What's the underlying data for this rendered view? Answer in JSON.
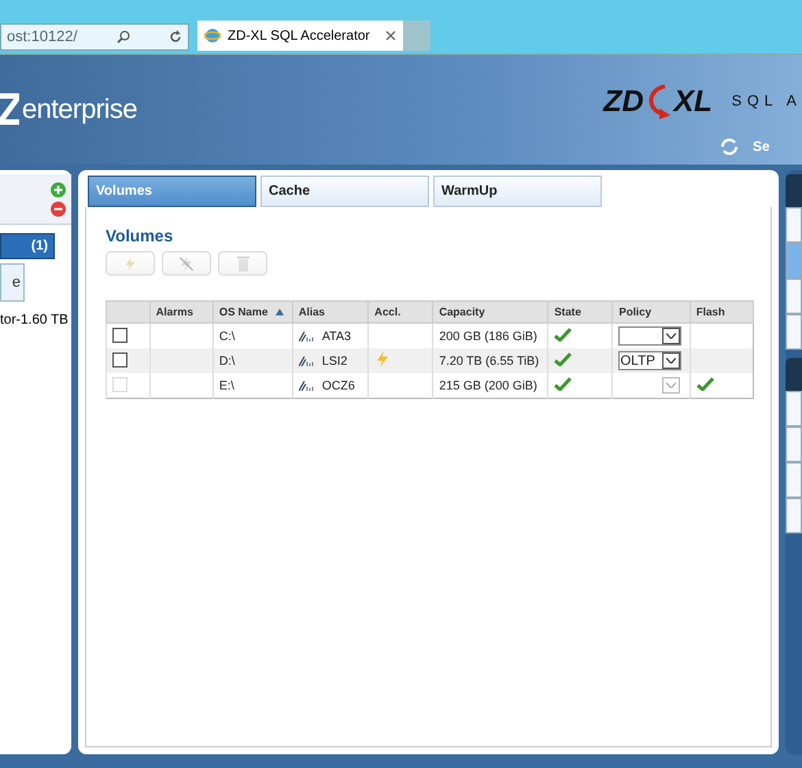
{
  "browser": {
    "address": "ost:10122/",
    "tab_title": "ZD-XL SQL Accelerator"
  },
  "header": {
    "brand": "enterprise",
    "logo_left": "ZD",
    "logo_right": "XL",
    "product": "SQL A",
    "link": "Se"
  },
  "left_panel": {
    "count": "(1)",
    "item_letter": "e",
    "item_caption": "tor-1.60 TB"
  },
  "tabs": [
    {
      "label": "Volumes",
      "selected": true
    },
    {
      "label": "Cache",
      "selected": false
    },
    {
      "label": "WarmUp",
      "selected": false
    }
  ],
  "heading": "Volumes",
  "toolbar": [
    {
      "kind": "accelerate",
      "disabled": true
    },
    {
      "kind": "decelerate",
      "disabled": true
    },
    {
      "kind": "delete",
      "disabled": true
    }
  ],
  "table": {
    "columns": [
      {
        "sorted": false
      },
      {
        "label": "Alarms",
        "sorted": false
      },
      {
        "label": "OS Name",
        "sorted": true
      },
      {
        "label": "Alias",
        "sorted": false
      },
      {
        "label": "Accl.",
        "sorted": false
      },
      {
        "label": "Capacity",
        "sorted": false
      },
      {
        "label": "State",
        "sorted": false
      },
      {
        "label": "Policy",
        "sorted": false
      },
      {
        "label": "Flash",
        "sorted": false
      }
    ],
    "rows": [
      {
        "checked": false,
        "check_disabled": false,
        "os_name": "C:\\",
        "alias": "ATA3",
        "accelerated": false,
        "capacity": "200 GB (186 GiB)",
        "state_ok": true,
        "policy": "",
        "policy_disabled": false,
        "flash": false
      },
      {
        "checked": false,
        "check_disabled": false,
        "os_name": "D:\\",
        "alias": "LSI2",
        "accelerated": true,
        "capacity": "7.20 TB (6.55 TiB)",
        "state_ok": true,
        "policy": "OLTP",
        "policy_disabled": false,
        "flash": false
      },
      {
        "checked": false,
        "check_disabled": true,
        "os_name": "E:\\",
        "alias": "OCZ6",
        "accelerated": false,
        "capacity": "215 GB (200 GiB)",
        "state_ok": true,
        "policy": "",
        "policy_disabled": true,
        "flash": true
      }
    ]
  },
  "right_panel": {
    "groups": [
      {
        "rows": [
          {
            "selected": false
          },
          {
            "selected": true
          },
          {
            "selected": false
          },
          {
            "selected": false
          }
        ]
      },
      {
        "rows": [
          {
            "selected": false
          },
          {
            "selected": false
          },
          {
            "selected": false
          },
          {
            "selected": false
          }
        ]
      }
    ]
  }
}
